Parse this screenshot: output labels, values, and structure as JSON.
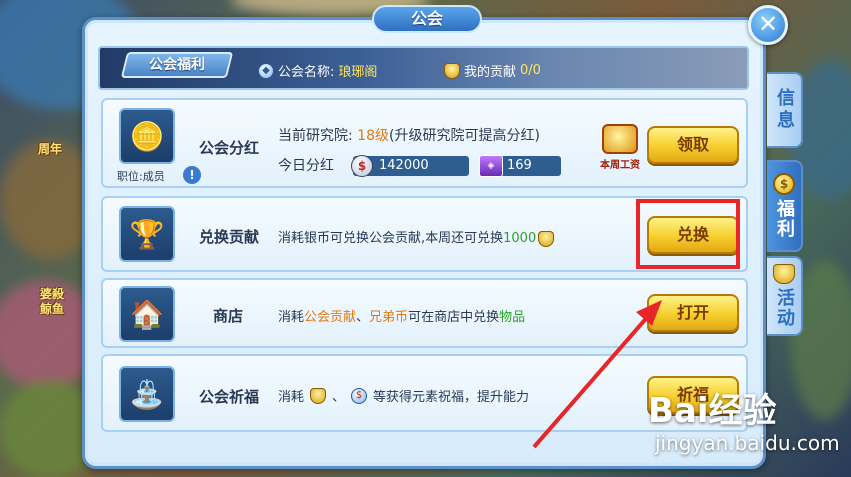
{
  "window": {
    "title": "公会",
    "close_icon": "close-icon"
  },
  "banner": {
    "label": "公会福利",
    "guild_name_label": "公会名称:",
    "guild_name_value": "琅琊阁",
    "contribution_label": "我的贡献",
    "contribution_value": "0/0"
  },
  "rows": {
    "dividend": {
      "name": "公会分红",
      "member_rank": "职位:成员",
      "line1_prefix": "当前研究院: ",
      "line1_level": "18级",
      "line1_suffix": "(升级研究院可提高分红)",
      "line2_label": "今日分红",
      "silver_value": "142000",
      "gem_value": "169",
      "weekly_badge": "本周工资",
      "button": "领取"
    },
    "exchange": {
      "name": "兑换贡献",
      "desc_prefix": "消耗银币可兑换公会贡献,本周还可兑换",
      "desc_amount": "1000",
      "button": "兑换"
    },
    "shop": {
      "name": "商店",
      "desc_1": "消耗",
      "desc_2": "公会贡献",
      "desc_3": "、",
      "desc_4": "兄弟币",
      "desc_5": "可在商店中兑换",
      "desc_6": "物品",
      "button": "打开"
    },
    "pray": {
      "name": "公会祈福",
      "desc_1": "消耗",
      "desc_2": "、",
      "desc_3": "等获得元素祝福，提升能力",
      "button": "祈福"
    }
  },
  "side_tabs": [
    {
      "label": "信息"
    },
    {
      "label": "福利"
    },
    {
      "label": "活动"
    }
  ],
  "background": {
    "left_labels": [
      "周年",
      "婆殺",
      "鲸鱼"
    ]
  },
  "watermark": {
    "logo": "Bai经验",
    "sub": "jingyan.baidu.com"
  },
  "colors": {
    "accent": "#2f6fc0",
    "highlight": "#e8262a",
    "button_gold": "#f6cf2c"
  }
}
